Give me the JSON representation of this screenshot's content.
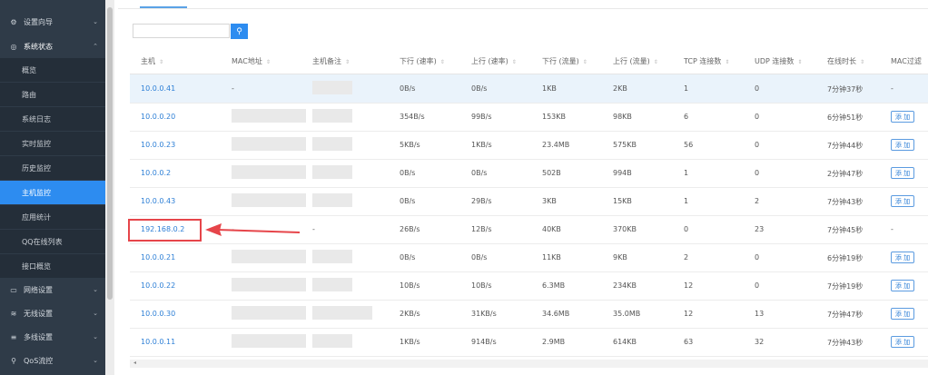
{
  "sidebar": {
    "items": [
      {
        "icon": "gear-icon",
        "label": "设置向导",
        "chev": "⌄",
        "y": 9
      },
      {
        "icon": "dashboard-icon",
        "label": "系统状态",
        "chev": "⌃",
        "y": 39
      }
    ],
    "subitems": [
      "概览",
      "路由",
      "系统日志",
      "实时监控",
      "历史监控",
      "主机监控",
      "应用统计",
      "QQ在线列表",
      "接口概览"
    ],
    "active_sub": "主机监控",
    "bottom_items": [
      {
        "icon": "monitor-icon",
        "label": "网络设置",
        "chev": "⌄"
      },
      {
        "icon": "wifi-icon",
        "label": "无线设置",
        "chev": "⌄"
      },
      {
        "icon": "multiline-icon",
        "label": "多线设置",
        "chev": "⌄"
      },
      {
        "icon": "qos-icon",
        "label": "QoS流控",
        "chev": "⌄"
      }
    ]
  },
  "search": {
    "placeholder": "",
    "button_icon": "search-icon"
  },
  "table": {
    "headers": [
      "主机",
      "MAC地址",
      "主机备注",
      "下行 (速率)",
      "上行 (速率)",
      "下行 (流量)",
      "上行 (流量)",
      "TCP 连接数",
      "UDP 连接数",
      "在线时长",
      "MAC过滤"
    ],
    "add_label": "添 加",
    "rows": [
      {
        "ip": "10.0.0.41",
        "mac": "-",
        "note": "",
        "down_rate": "0B/s",
        "up_rate": "0B/s",
        "down_flow": "1KB",
        "up_flow": "2KB",
        "tcp": "1",
        "udp": "0",
        "online": "7分钟37秒",
        "filter": "-"
      },
      {
        "ip": "10.0.0.20",
        "mac": "",
        "note": "",
        "down_rate": "354B/s",
        "up_rate": "99B/s",
        "down_flow": "153KB",
        "up_flow": "98KB",
        "tcp": "6",
        "udp": "0",
        "online": "6分钟51秒",
        "filter": "add"
      },
      {
        "ip": "10.0.0.23",
        "mac": "",
        "note": "",
        "down_rate": "5KB/s",
        "up_rate": "1KB/s",
        "down_flow": "23.4MB",
        "up_flow": "575KB",
        "tcp": "56",
        "udp": "0",
        "online": "7分钟44秒",
        "filter": "add"
      },
      {
        "ip": "10.0.0.2",
        "mac": "",
        "note": "",
        "down_rate": "0B/s",
        "up_rate": "0B/s",
        "down_flow": "502B",
        "up_flow": "994B",
        "tcp": "1",
        "udp": "0",
        "online": "2分钟47秒",
        "filter": "add"
      },
      {
        "ip": "10.0.0.43",
        "mac": "",
        "note": "",
        "down_rate": "0B/s",
        "up_rate": "29B/s",
        "down_flow": "3KB",
        "up_flow": "15KB",
        "tcp": "1",
        "udp": "2",
        "online": "7分钟43秒",
        "filter": "add"
      },
      {
        "ip": "192.168.0.2",
        "mac": "-",
        "note": "-",
        "down_rate": "26B/s",
        "up_rate": "12B/s",
        "down_flow": "40KB",
        "up_flow": "370KB",
        "tcp": "0",
        "udp": "23",
        "online": "7分钟45秒",
        "filter": "-"
      },
      {
        "ip": "10.0.0.21",
        "mac": "",
        "note": "",
        "down_rate": "0B/s",
        "up_rate": "0B/s",
        "down_flow": "11KB",
        "up_flow": "9KB",
        "tcp": "2",
        "udp": "0",
        "online": "6分钟19秒",
        "filter": "add"
      },
      {
        "ip": "10.0.0.22",
        "mac": "",
        "note": "",
        "down_rate": "10B/s",
        "up_rate": "10B/s",
        "down_flow": "6.3MB",
        "up_flow": "234KB",
        "tcp": "12",
        "udp": "0",
        "online": "7分钟19秒",
        "filter": "add"
      },
      {
        "ip": "10.0.0.30",
        "mac": "",
        "note": "",
        "down_rate": "2KB/s",
        "up_rate": "31KB/s",
        "down_flow": "34.6MB",
        "up_flow": "35.0MB",
        "tcp": "12",
        "udp": "13",
        "online": "7分钟47秒",
        "filter": "add"
      },
      {
        "ip": "10.0.0.11",
        "mac": "",
        "note": "",
        "down_rate": "1KB/s",
        "up_rate": "914B/s",
        "down_flow": "2.9MB",
        "up_flow": "614KB",
        "tcp": "63",
        "udp": "32",
        "online": "7分钟43秒",
        "filter": "add"
      }
    ]
  },
  "colors": {
    "sidebar_bg": "#2f3b48",
    "accent": "#2d8cf0",
    "highlight_row": "#eaf3fb",
    "annotation": "#e6454a"
  }
}
